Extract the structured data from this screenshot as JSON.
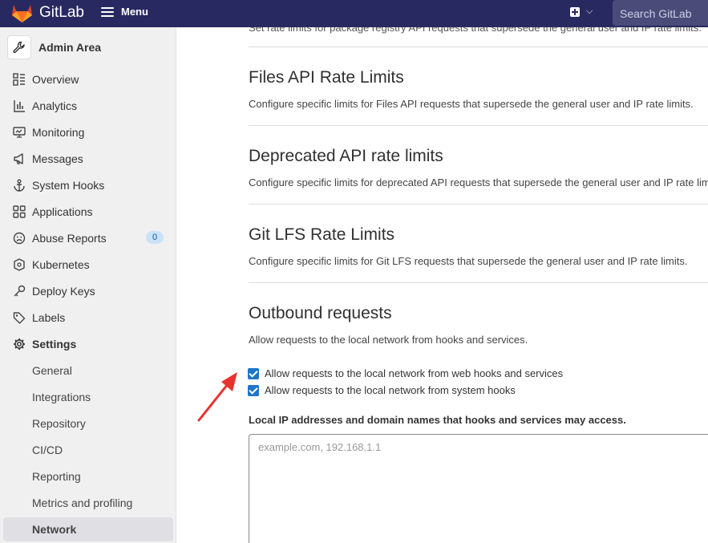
{
  "header": {
    "brand": "GitLab",
    "menu_label": "Menu",
    "search_placeholder": "Search GitLab"
  },
  "sidebar": {
    "title": "Admin Area",
    "items": [
      {
        "label": "Overview"
      },
      {
        "label": "Analytics"
      },
      {
        "label": "Monitoring"
      },
      {
        "label": "Messages"
      },
      {
        "label": "System Hooks"
      },
      {
        "label": "Applications"
      },
      {
        "label": "Abuse Reports",
        "badge": "0"
      },
      {
        "label": "Kubernetes"
      },
      {
        "label": "Deploy Keys"
      },
      {
        "label": "Labels"
      },
      {
        "label": "Settings"
      }
    ],
    "settings_items": [
      {
        "label": "General"
      },
      {
        "label": "Integrations"
      },
      {
        "label": "Repository"
      },
      {
        "label": "CI/CD"
      },
      {
        "label": "Reporting"
      },
      {
        "label": "Metrics and profiling"
      },
      {
        "label": "Network"
      }
    ]
  },
  "main": {
    "clipped_text": "Set rate limits for package registry API requests that supersede the general user and IP rate limits.",
    "sections": [
      {
        "title": "Files API Rate Limits",
        "description": "Configure specific limits for Files API requests that supersede the general user and IP rate limits."
      },
      {
        "title": "Deprecated API rate limits",
        "description": "Configure specific limits for deprecated API requests that supersede the general user and IP rate limits."
      },
      {
        "title": "Git LFS Rate Limits",
        "description": "Configure specific limits for Git LFS requests that supersede the general user and IP rate limits."
      }
    ],
    "outbound": {
      "title": "Outbound requests",
      "description": "Allow requests to the local network from hooks and services.",
      "checkbox_web_hooks": "Allow requests to the local network from web hooks and services",
      "checkbox_system_hooks": "Allow requests to the local network from system hooks",
      "allowlist_label": "Local IP addresses and domain names that hooks and services may access.",
      "allowlist_placeholder": "example.com, 192.168.1.1"
    }
  },
  "colors": {
    "topbar": "#292961",
    "accent": "#1f75cb",
    "annotation_arrow": "#e8322f"
  }
}
